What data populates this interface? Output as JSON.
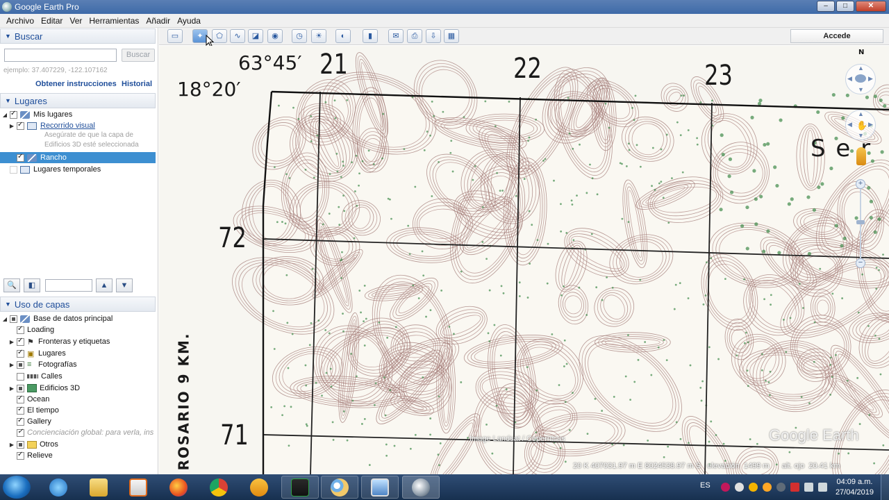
{
  "window": {
    "title": "Google Earth Pro",
    "min": "–",
    "max": "□",
    "close": "✕"
  },
  "menu": [
    "Archivo",
    "Editar",
    "Ver",
    "Herramientas",
    "Añadir",
    "Ayuda"
  ],
  "search": {
    "header": "Buscar",
    "placeholder": "",
    "button": "Buscar",
    "example": "ejemplo: 37.407229, -122.107162",
    "directions": "Obtener instrucciones",
    "history": "Historial"
  },
  "places": {
    "header": "Lugares",
    "my_places": "Mis lugares",
    "tour": "Recorrido visual",
    "tour_hint_1": "Asegúrate de que la capa de",
    "tour_hint_2": "Edificios 3D esté seleccionada",
    "rancho": "Rancho",
    "temp": "Lugares temporales"
  },
  "layers": {
    "header": "Uso de capas",
    "items": [
      "Base de datos principal",
      "Loading",
      "Fronteras y etiquetas",
      "Lugares",
      "Fotografías",
      "Calles",
      "Edificios 3D",
      "Ocean",
      "El tiempo",
      "Gallery",
      "Concienciación global: para verla, ins",
      "Otros",
      "Relieve"
    ]
  },
  "toolbar": {
    "signin": "Accede"
  },
  "map": {
    "coord_lon": "63°45′",
    "coord_lat": "18°20′",
    "grid_labels": [
      "21",
      "22",
      "23",
      "72",
      "71"
    ],
    "side_text": "ROSARIO 9 KM.",
    "map_text": "S e r",
    "north": "N",
    "credit": "Image Landsat / Copernicus",
    "watermark": "Google Earth",
    "status": "20 K 407031.97 m E 8024538.97 m S   elevación  1499 m      alt. ojo  20.41 km"
  },
  "taskbar": {
    "lang": "ES",
    "time": "04:09 a.m.",
    "date": "27/04/2019"
  }
}
